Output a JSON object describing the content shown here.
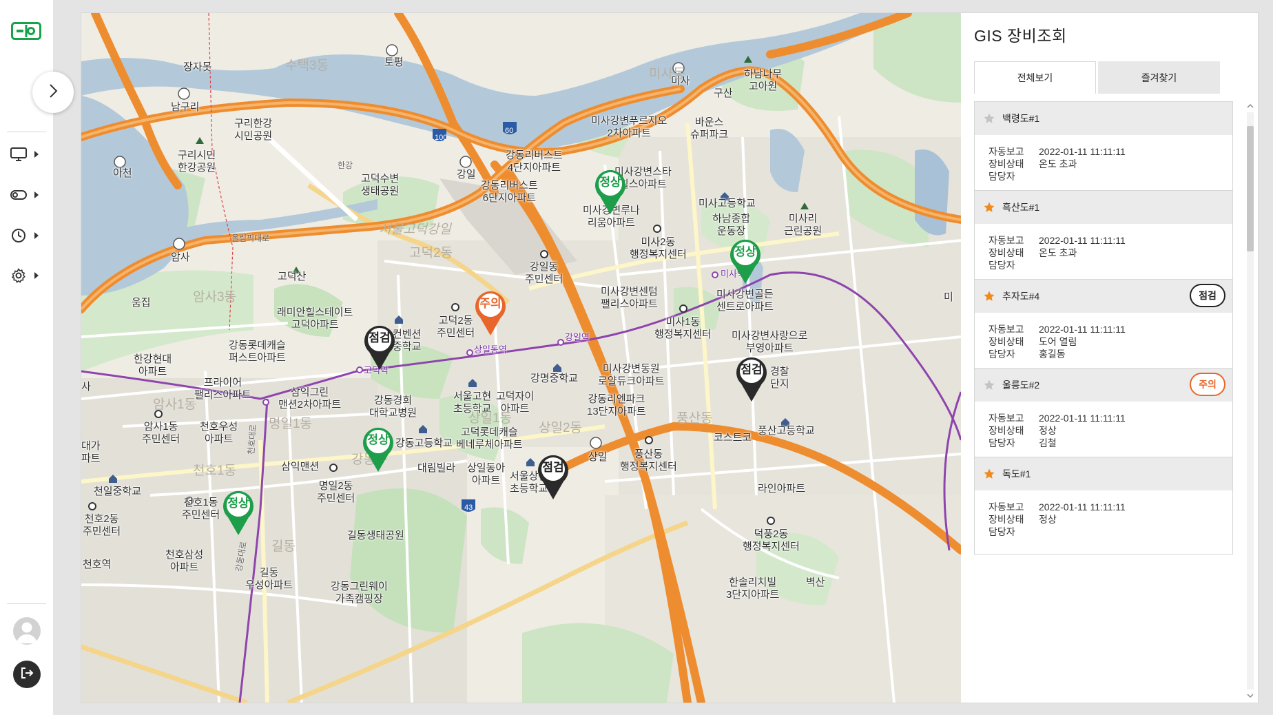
{
  "panel": {
    "title": "GIS 장비조회",
    "tabs": [
      "전체보기",
      "즐겨찾기"
    ]
  },
  "field_labels": {
    "auto_report": "자동보고",
    "status": "장비상태",
    "manager": "담당자"
  },
  "devices": [
    {
      "name": "백령도#1",
      "starred": false,
      "badge": "",
      "datetime": "2022-01-11  11:11:11",
      "status": "온도 초과",
      "manager": ""
    },
    {
      "name": "흑산도#1",
      "starred": true,
      "badge": "",
      "datetime": "2022-01-11  11:11:11",
      "status": "온도 초과",
      "manager": ""
    },
    {
      "name": "추자도#4",
      "starred": true,
      "badge": "점검",
      "badge_color": "#222222",
      "datetime": "2022-01-11  11:11:11",
      "status": "도어 열림",
      "manager": "홍길동"
    },
    {
      "name": "울릉도#2",
      "starred": false,
      "badge": "주의",
      "badge_color": "#e8662c",
      "datetime": "2022-01-11  11:11:11",
      "status": "정상",
      "manager": "김철"
    },
    {
      "name": "독도#1",
      "starred": true,
      "badge": "",
      "datetime": "2022-01-11  11:11:11",
      "status": "정상",
      "manager": ""
    }
  ],
  "pins": [
    {
      "label": "정상",
      "color": "#1e9e4a"
    },
    {
      "label": "정상",
      "color": "#1e9e4a"
    },
    {
      "label": "주의",
      "color": "#e8662c"
    },
    {
      "label": "점검",
      "color": "#2a2a2a"
    },
    {
      "label": "점검",
      "color": "#2a2a2a"
    },
    {
      "label": "정상",
      "color": "#1e9e4a"
    },
    {
      "label": "점검",
      "color": "#2a2a2a"
    },
    {
      "label": "정상",
      "color": "#1e9e4a"
    }
  ],
  "map_labels": {
    "jangjamot": "장자못",
    "sutaek3": "수택3동",
    "topyeong": "토평",
    "namguri": "남구리",
    "guri_park": "구리한강\n시민공원",
    "guri_park2": "구리시민\n한강공원",
    "acheon": "아천",
    "amsa": "암사",
    "hangang": "한강",
    "olympic_rd": "올림픽대로",
    "godeok_eco": "고덕수변\n생태공원",
    "gangil": "강일",
    "seoul_godeok": "서울고덕강일",
    "godeok2": "고덕2동",
    "godeoksan": "고덕산",
    "umjip": "움집",
    "amsa3": "암사3동",
    "raemian": "래미안힐스테이트\n고덕아파트",
    "gangdong_lotte": "강동롯데캐슬\n퍼스트아파트",
    "hangang_hyundai": "한강현대\n아파트",
    "prior": "프라이어\n팰리스아파트",
    "samik": "삼익그린\n맨션2차아파트",
    "amsa1_center": "암사1동\n주민센터",
    "cheonho_woosung": "천호우성\n아파트",
    "amsa1": "암사1동",
    "myeongil1": "명일1동",
    "cheonho1": "천호1동",
    "cheonil_ms": "천일중학교",
    "cheonho1_center": "천호1동\n주민센터",
    "cheonho2_center": "천호2동\n주민센터",
    "cheonho_station": "천호역",
    "cheonho_samsung": "천호삼성\n아파트",
    "gildong": "길동",
    "gildong_woosung": "길동\n우성아파트",
    "gangdong_greenway": "강동그린웨이\n가족캠핑장",
    "gildong_eco": "길동생태공원",
    "myeongil2_center": "명일2동\n주민센터",
    "samik_mansion": "삼익맨션",
    "gangdong_gu": "강동구",
    "gangdong_hs": "강동고등학교",
    "gangdong_hospital": "강동경희\n대학교병원",
    "seoul_godeok_es": "서울고현\n초등학교",
    "godeok_zai": "고덕자이\n아파트",
    "godeok_lotte": "고덕롯데캐슬\n베네루체아파트",
    "daerim": "대림빌라",
    "sangil_dongah": "상일동아\n아파트",
    "seoul_sangil_es": "서울상일\n초등학교",
    "sangil1": "상일1동",
    "sangil2": "상일2동",
    "godeok_station": "고덕역",
    "sangil_station": "상일동역",
    "gangil_station": "강일역",
    "godeok2_center": "고덕2동\n주민센터",
    "gangil_center": "강일동\n주민센터",
    "gangdong_rivers6": "강동리버스트\n6단지아파트",
    "gangdong_rivers4": "강동리버스트\n4단지아파트",
    "gangmyeong_ms": "강명중학교",
    "convention": "컨벤션\n중학교",
    "misa_riverpark": "미사강변푸르지오\n2차아파트",
    "misa_star": "미사강변스타\n힐스아파트",
    "misa_riverna": "미사강변루나\n리움아파트",
    "misa2_center": "미사2동\n행정복지센터",
    "misa_terrace": "미사강변센텀\n팰리스아파트",
    "misa1_center": "미사1동\n행정복지센터",
    "misa_golden": "미사강변골든\n센트로아파트",
    "misa_sarang": "미사강변사랑으로\n부영아파트",
    "misa_dongwon": "미사강변동원\n로얄듀크아파트",
    "gangdong_lien13": "강동리엔파크\n13단지아파트",
    "misa_hs": "미사고등학교",
    "hanam_sports": "하남종합\n운동장",
    "misa_park": "미사리\n근린공원",
    "baunce": "바운스\n슈퍼파크",
    "gusan": "구산",
    "hanam_tree": "하남나무\n고아원",
    "misa_ic": "미사",
    "misa_station": "미사역",
    "pungsan": "풍산동",
    "pungsan_center": "풍산동\n행정복지센터",
    "costco": "코스트코",
    "pungsan_hs": "풍산고등학교",
    "laein": "라인아파트",
    "deokpung2_center": "덕풍2동\n행정복지센터",
    "hansol": "한솔리치빌\n3단지아파트",
    "byeoksan": "벽산",
    "gyeongchal": "경찰\n단지",
    "sangil_ic": "상일",
    "gangdong_daero": "강동대로",
    "cheonho_daero": "천호대로",
    "dokdeok": "덕",
    "daega": "대가\n파트",
    "sa": "사",
    "route100": "100",
    "route60": "60",
    "route43": "43",
    "misa_dong": "미사동",
    "mi": "미"
  }
}
